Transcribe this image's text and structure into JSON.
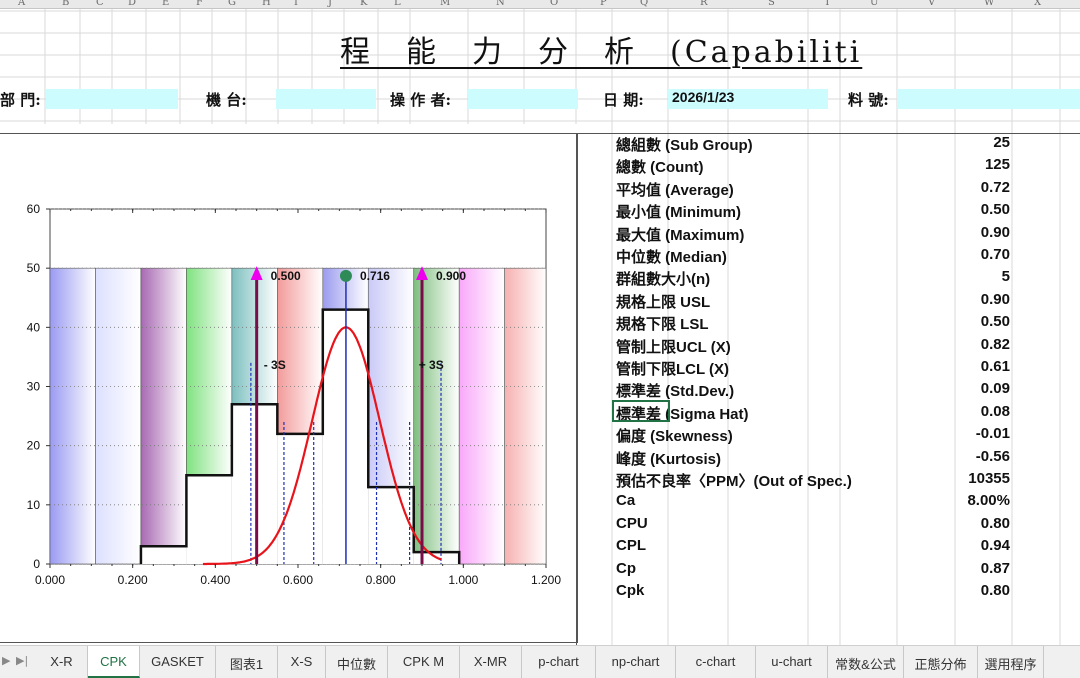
{
  "column_headers": [
    "A",
    "B",
    "C",
    "D",
    "E",
    "F",
    "G",
    "H",
    "I",
    "J",
    "K",
    "L",
    "M",
    "N",
    "O",
    "P",
    "Q",
    "R",
    "S",
    "T",
    "U",
    "V",
    "W",
    "X"
  ],
  "title": "程　能　力　分　析　(Capabiliti",
  "header_fields": {
    "dept_label": "部 門:",
    "machine_label": "機 台:",
    "operator_label": "操 作 者:",
    "date_label": "日 期:",
    "date_value": "2026/1/23",
    "part_label": "料 號:"
  },
  "stats": [
    {
      "label": "總組數 (Sub Group)",
      "value": "25"
    },
    {
      "label": "總數 (Count)",
      "value": "125"
    },
    {
      "label": "平均值 (Average)",
      "value": "0.72"
    },
    {
      "label": "最小值 (Minimum)",
      "value": "0.50"
    },
    {
      "label": "最大值 (Maximum)",
      "value": "0.90"
    },
    {
      "label": "中位數 (Median)",
      "value": "0.70"
    },
    {
      "label": "群組數大小(n)",
      "value": "5"
    },
    {
      "label": "規格上限 USL",
      "value": "0.90"
    },
    {
      "label": "規格下限 LSL",
      "value": "0.50"
    },
    {
      "label": "管制上限UCL (X)",
      "value": "0.82"
    },
    {
      "label": "管制下限LCL (X)",
      "value": "0.61"
    },
    {
      "label": "標準差 (Std.Dev.)",
      "value": "0.09"
    },
    {
      "label": "標準差 (Sigma Hat)",
      "value": "0.08"
    },
    {
      "label": "偏度 (Skewness)",
      "value": "-0.01"
    },
    {
      "label": "峰度 (Kurtosis)",
      "value": "-0.56"
    },
    {
      "label": "預估不良率〈PPM〉(Out of Spec.)",
      "value": "10355"
    },
    {
      "label": "Ca",
      "value": "8.00%"
    },
    {
      "label": "CPU",
      "value": "0.80"
    },
    {
      "label": "CPL",
      "value": "0.94"
    },
    {
      "label": "Cp",
      "value": "0.87"
    },
    {
      "label": "Cpk",
      "value": "0.80"
    }
  ],
  "chart_data": {
    "type": "bar",
    "x_ticks": [
      "0.000",
      "0.200",
      "0.400",
      "0.600",
      "0.800",
      "1.000",
      "1.200"
    ],
    "y_ticks": [
      "0",
      "10",
      "20",
      "30",
      "40",
      "50",
      "60"
    ],
    "xlim": [
      0,
      1.2
    ],
    "ylim": [
      0,
      60
    ],
    "background_bands": [
      {
        "x0": 0.0,
        "x1": 0.11,
        "color": "#9a9af2"
      },
      {
        "x0": 0.11,
        "x1": 0.22,
        "color": "#dde0ff"
      },
      {
        "x0": 0.22,
        "x1": 0.33,
        "color": "#a869b3"
      },
      {
        "x0": 0.33,
        "x1": 0.44,
        "color": "#7fe27f"
      },
      {
        "x0": 0.44,
        "x1": 0.55,
        "color": "#7dbfbf"
      },
      {
        "x0": 0.55,
        "x1": 0.66,
        "color": "#f39a9a"
      },
      {
        "x0": 0.66,
        "x1": 0.77,
        "color": "#9b9bf0"
      },
      {
        "x0": 0.77,
        "x1": 0.88,
        "color": "#c9c9f7"
      },
      {
        "x0": 0.88,
        "x1": 0.99,
        "color": "#7fbf7f"
      },
      {
        "x0": 0.99,
        "x1": 1.1,
        "color": "#f9a8f9"
      },
      {
        "x0": 1.1,
        "x1": 1.21,
        "color": "#f7b0b0"
      }
    ],
    "histogram": [
      {
        "x0": 0.22,
        "x1": 0.33,
        "value": 3
      },
      {
        "x0": 0.33,
        "x1": 0.44,
        "value": 15
      },
      {
        "x0": 0.44,
        "x1": 0.55,
        "value": 27
      },
      {
        "x0": 0.55,
        "x1": 0.66,
        "value": 22
      },
      {
        "x0": 0.66,
        "x1": 0.77,
        "value": 43
      },
      {
        "x0": 0.77,
        "x1": 0.88,
        "value": 13
      },
      {
        "x0": 0.88,
        "x1": 0.99,
        "value": 2
      }
    ],
    "normal_curve": {
      "mean": 0.716,
      "sd": 0.0817,
      "peak": 40
    },
    "markers": [
      {
        "x": 0.5,
        "label": "0.500",
        "color": "#ee00ee",
        "shape": "triangle"
      },
      {
        "x": 0.716,
        "label": "0.716",
        "color": "#2e8b57",
        "shape": "circle"
      },
      {
        "x": 0.9,
        "label": "0.900",
        "color": "#ee00ee",
        "shape": "triangle"
      }
    ],
    "sigma_labels": [
      {
        "x": 0.517,
        "label": "- 3S"
      },
      {
        "x": 0.892,
        "label": "+ 3S"
      }
    ],
    "dashed_lines": [
      {
        "x": 0.486,
        "top": 34
      },
      {
        "x": 0.566,
        "top": 24
      },
      {
        "x": 0.638,
        "top": 24
      },
      {
        "x": 0.79,
        "top": 24
      },
      {
        "x": 0.87,
        "top": 24
      },
      {
        "x": 0.946,
        "top": 34
      }
    ],
    "grid": "horizontal-dotted"
  },
  "sheet_tabs": [
    {
      "label": "X-R",
      "active": false
    },
    {
      "label": "CPK",
      "active": true
    },
    {
      "label": "GASKET",
      "active": false
    },
    {
      "label": "图表1",
      "active": false
    },
    {
      "label": "X-S",
      "active": false
    },
    {
      "label": "中位數",
      "active": false
    },
    {
      "label": "CPK M",
      "active": false
    },
    {
      "label": "X-MR",
      "active": false
    },
    {
      "label": "p-chart",
      "active": false
    },
    {
      "label": "np-chart",
      "active": false
    },
    {
      "label": "c-chart",
      "active": false
    },
    {
      "label": "u-chart",
      "active": false
    },
    {
      "label": "常数&公式",
      "active": false
    },
    {
      "label": "正態分佈",
      "active": false
    },
    {
      "label": "選用程序",
      "active": false
    }
  ]
}
